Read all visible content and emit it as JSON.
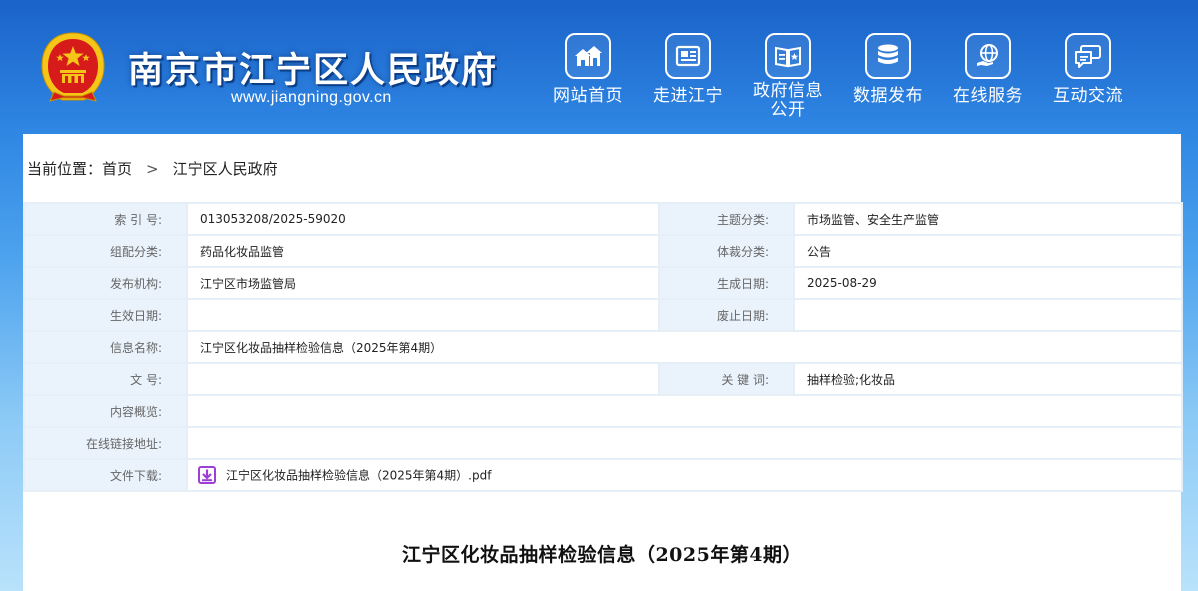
{
  "header": {
    "site_title": "南京市江宁区人民政府",
    "site_url": "www.jiangning.gov.cn",
    "nav": [
      {
        "label": "网站首页",
        "icon": "houses-icon"
      },
      {
        "label": "走进江宁",
        "icon": "newspaper-icon"
      },
      {
        "label": "政府信息公开",
        "line1": "政府信息",
        "line2": "公开",
        "icon": "open-book-icon"
      },
      {
        "label": "数据发布",
        "icon": "database-icon"
      },
      {
        "label": "在线服务",
        "icon": "globe-hand-icon"
      },
      {
        "label": "互动交流",
        "icon": "chat-bubbles-icon"
      }
    ]
  },
  "breadcrumb": {
    "prefix": "当前位置：",
    "home": "首页",
    "separator": ">",
    "current": "江宁区人民政府"
  },
  "meta": {
    "index_label": "索 引 号:",
    "index_value": "013053208/2025-59020",
    "theme_label": "主题分类:",
    "theme_value": "市场监管、安全生产监管",
    "org_category_label": "组配分类:",
    "org_category_value": "药品化妆品监管",
    "genre_label": "体裁分类:",
    "genre_value": "公告",
    "publisher_label": "发布机构:",
    "publisher_value": "江宁区市场监管局",
    "created_label": "生成日期:",
    "created_value": "2025-08-29",
    "effective_label": "生效日期:",
    "effective_value": "",
    "abolished_label": "废止日期:",
    "abolished_value": "",
    "name_label": "信息名称:",
    "name_value": "江宁区化妆品抽样检验信息（2025年第4期）",
    "doc_no_label": "文 号:",
    "doc_no_value": "",
    "keywords_label": "关 键 词:",
    "keywords_value": "抽样检验;化妆品",
    "overview_label": "内容概览:",
    "overview_value": "",
    "link_label": "在线链接地址:",
    "link_value": "",
    "download_label": "文件下载:",
    "download_value": "江宁区化妆品抽样检验信息（2025年第4期）.pdf"
  },
  "article": {
    "title": "江宁区化妆品抽样检验信息（2025年第4期）"
  },
  "colors": {
    "header_blue": "#1a63c9",
    "label_cell_bg": "#eaf3fc",
    "border": "#e6eef7",
    "emblem_red": "#d71b1b",
    "emblem_gold": "#f5c518",
    "pdf_icon_purple": "#9b3fd6"
  }
}
